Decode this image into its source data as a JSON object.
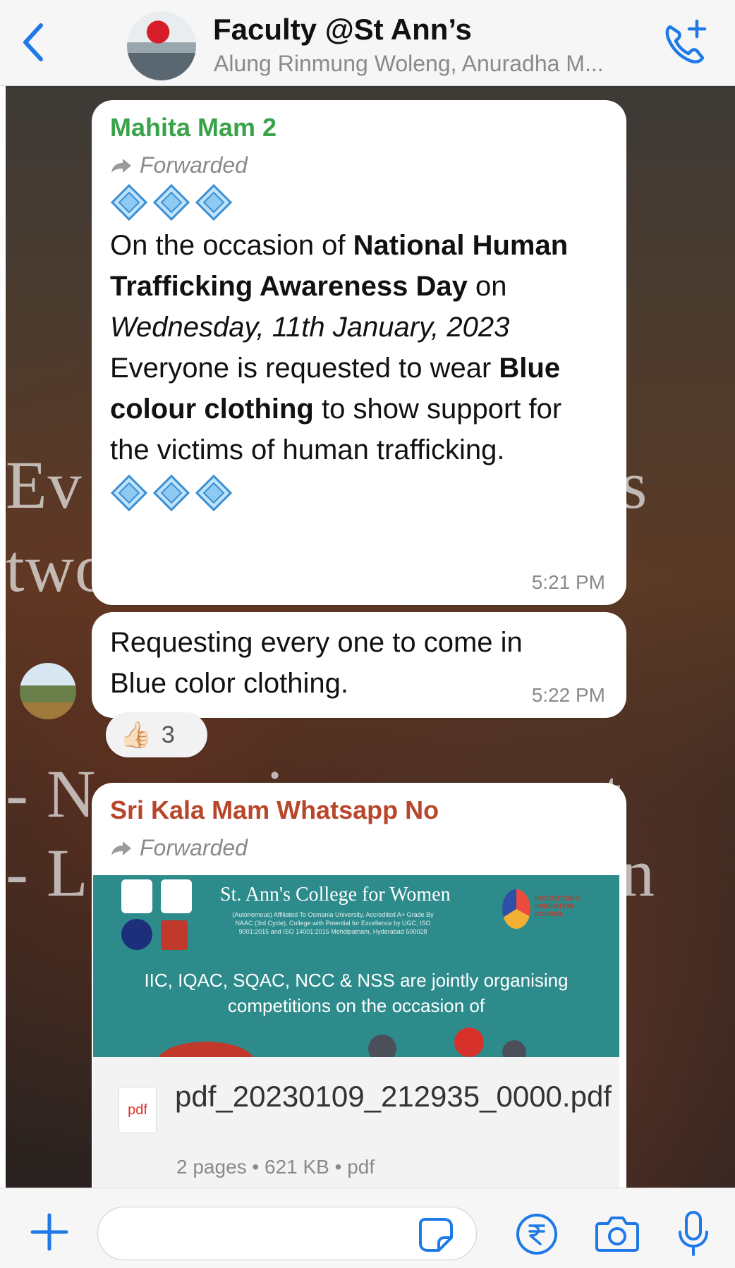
{
  "header": {
    "title": "Faculty @St Ann’s",
    "subtitle": "Alung Rinmung Woleng, Anuradha M..."
  },
  "wallpaper": {
    "line1": "Ev",
    "line1b": "s",
    "line2": "two",
    "line3": "- No one is permanent",
    "line4": "- L",
    "line4b": "n"
  },
  "messages": {
    "m1": {
      "sender": "Mahita Mam 2",
      "sender_color": "#3aa34a",
      "forwarded": "Forwarded",
      "t1": "On the occasion of ",
      "b1": "National Human Trafficking Awareness Day",
      "t2": "  on ",
      "i1": "Wednesday, 11th January, 2023",
      "t3": "Everyone is requested to wear ",
      "b2": "Blue colour clothing",
      "t4": " to show support for the victims of human trafficking.",
      "time": "5:21 PM"
    },
    "m2": {
      "text": "Requesting every one to come in Blue color clothing.",
      "time": "5:22 PM",
      "reaction_emoji": "👍🏻",
      "reaction_count": "3"
    },
    "m3": {
      "sender": "Sri Kala Mam Whatsapp No",
      "sender_color": "#b8462b",
      "forwarded": "Forwarded",
      "poster_college": "St. Ann's College for Women",
      "poster_small": "(Autonomous) Affiliated To Osmania University, Accredited A+ Grade By NAAC (3rd Cycle), College with Potential for Excellence by UGC, ISO 9001:2015 and ISO 14001:2015 Mehdipatnam, Hyderabad 500028",
      "poster_org": "IIC, IQAC, SQAC, NCC & NSS  are jointly organising",
      "poster_occasion": "competitions on the occasion of",
      "poster_iic": "INSTITUTION'S INNOVATION COUNCIL",
      "pdf_label": "pdf",
      "doc_name": "pdf_20230109_212935_0000.pdf",
      "doc_meta": "2 pages • 621 KB • pdf"
    }
  },
  "composer": {
    "placeholder": ""
  },
  "icons": {
    "back": "chevron-left-icon",
    "call": "add-call-icon",
    "plus": "plus-icon",
    "sticker": "sticker-icon",
    "rupee": "rupee-payment-icon",
    "camera": "camera-icon",
    "mic": "microphone-icon"
  },
  "colors": {
    "accent": "#1f7ae8"
  }
}
